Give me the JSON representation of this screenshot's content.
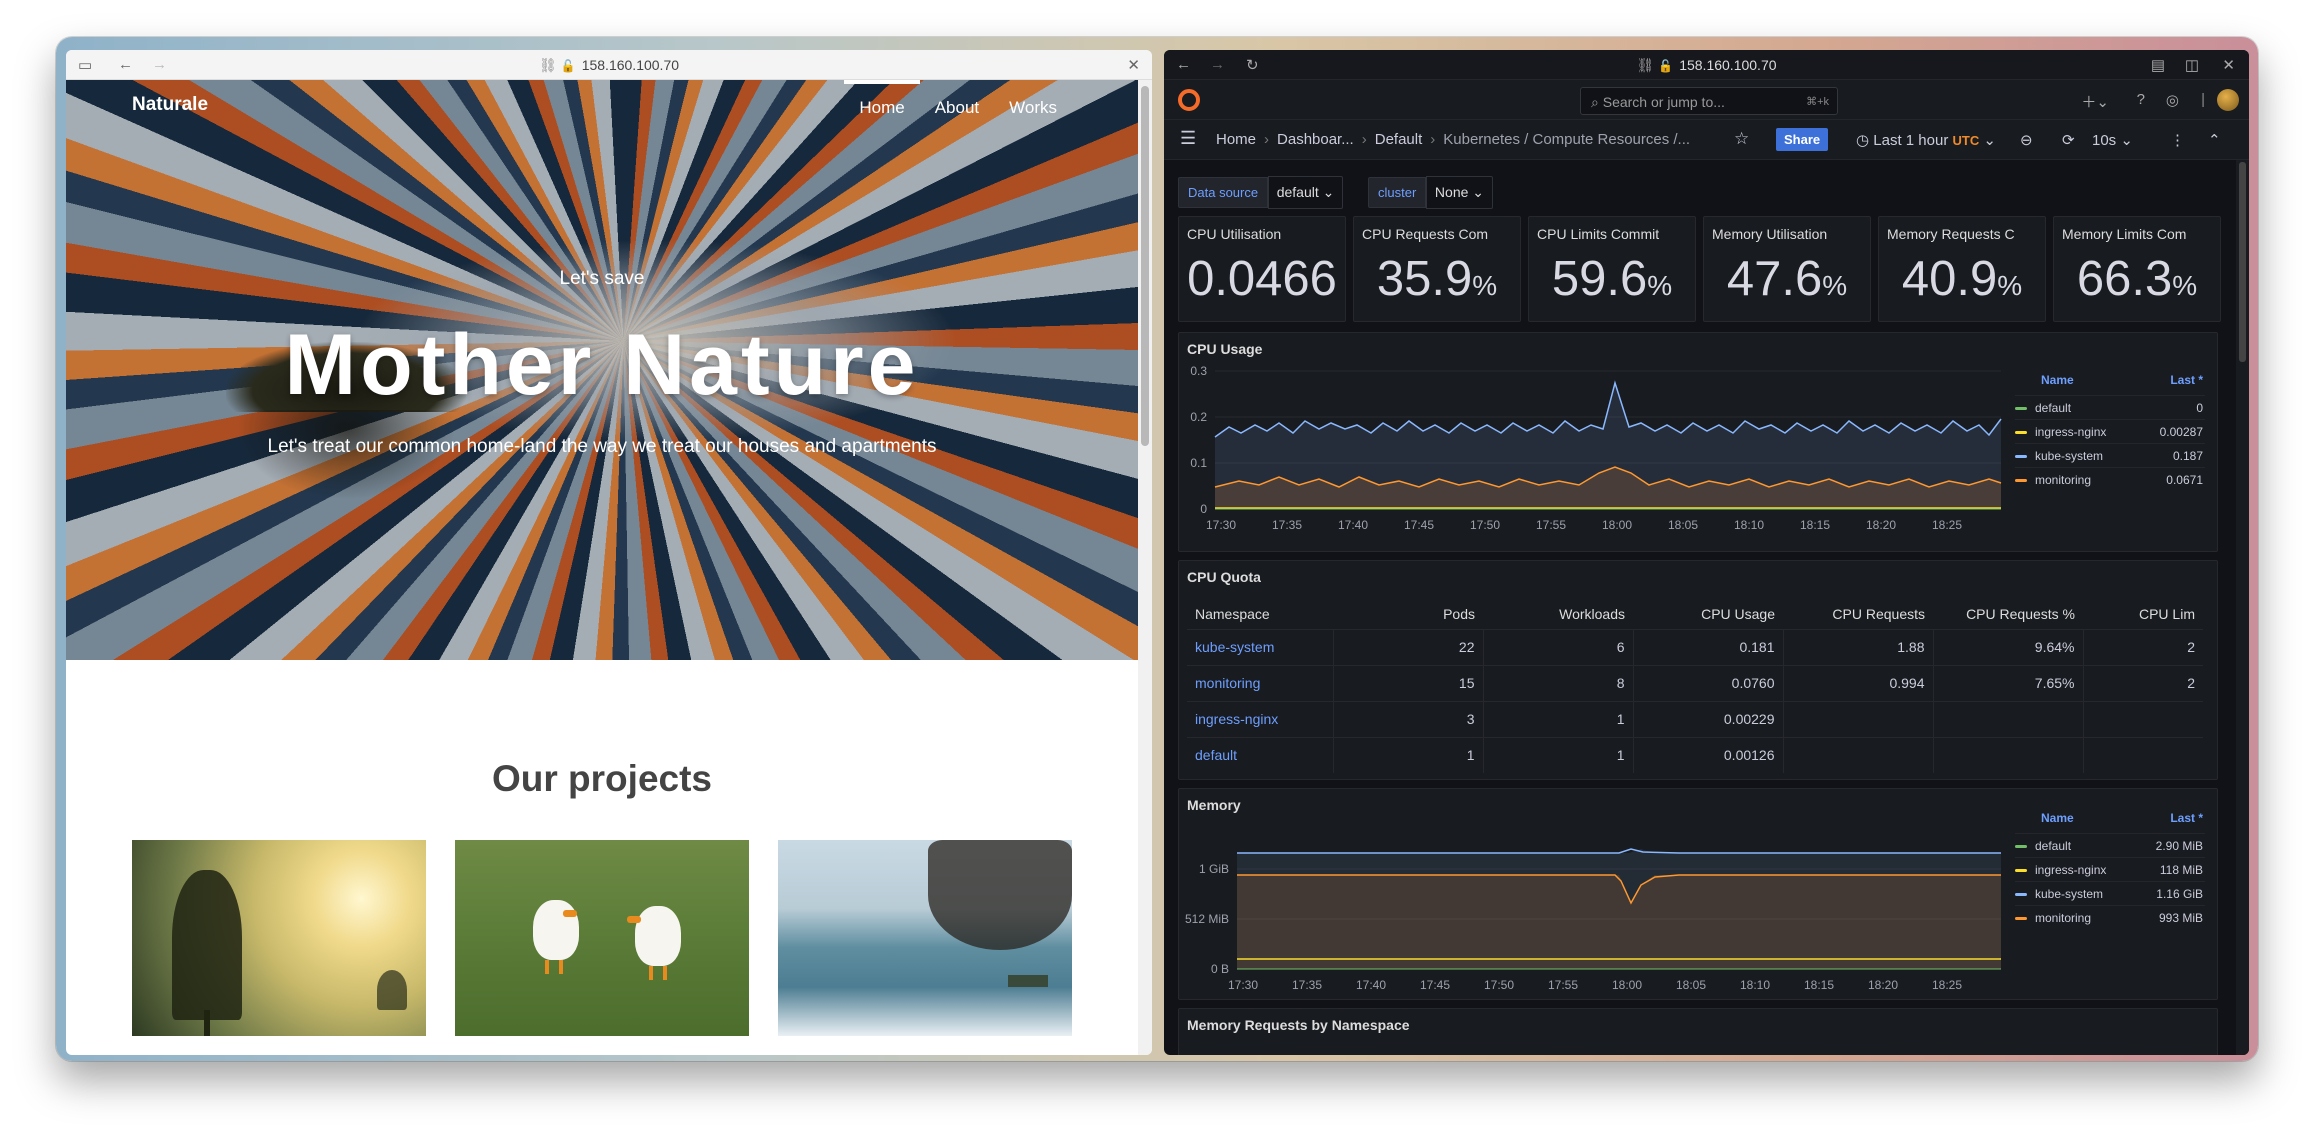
{
  "left_browser": {
    "url": "158.160.100.70",
    "site": {
      "brand": "Naturale",
      "nav": [
        "Home",
        "About",
        "Works"
      ],
      "hero_subtitle": "Let's save",
      "hero_title": "Mother Nature",
      "hero_description": "Let's treat our common home-land the way we treat our houses and apartments",
      "projects_title": "Our projects"
    }
  },
  "right_browser": {
    "url": "158.160.100.70",
    "search_placeholder": "Search or jump to...",
    "search_shortcut": "⌘+k",
    "breadcrumbs": [
      "Home",
      "Dashboar...",
      "Default",
      "Kubernetes / Compute Resources /..."
    ],
    "share_label": "Share",
    "time_range": "Last 1 hour",
    "timezone": "UTC",
    "refresh": "10s",
    "variables": [
      {
        "label": "Data source",
        "value": "default"
      },
      {
        "label": "cluster",
        "value": "None"
      }
    ],
    "stats": [
      {
        "title": "CPU Utilisation",
        "value": "0.0466",
        "unit": ""
      },
      {
        "title": "CPU Requests Com",
        "value": "35.9",
        "unit": "%"
      },
      {
        "title": "CPU Limits Commit",
        "value": "59.6",
        "unit": "%"
      },
      {
        "title": "Memory Utilisation",
        "value": "47.6",
        "unit": "%"
      },
      {
        "title": "Memory Requests C",
        "value": "40.9",
        "unit": "%"
      },
      {
        "title": "Memory Limits Com",
        "value": "66.3",
        "unit": "%"
      }
    ],
    "cpu_usage": {
      "title": "CPU Usage",
      "legend_header": {
        "name": "Name",
        "last": "Last *"
      },
      "legend": [
        {
          "name": "default",
          "last": "0",
          "color": "#73bf69"
        },
        {
          "name": "ingress-nginx",
          "last": "0.00287",
          "color": "#fade2a"
        },
        {
          "name": "kube-system",
          "last": "0.187",
          "color": "#8ab8ff"
        },
        {
          "name": "monitoring",
          "last": "0.0671",
          "color": "#ff9830"
        }
      ],
      "y_ticks": [
        "0.3",
        "0.2",
        "0.1",
        "0"
      ],
      "x_ticks": [
        "17:30",
        "17:35",
        "17:40",
        "17:45",
        "17:50",
        "17:55",
        "18:00",
        "18:05",
        "18:10",
        "18:15",
        "18:20",
        "18:25"
      ]
    },
    "cpu_quota": {
      "title": "CPU Quota",
      "columns": [
        "Namespace",
        "Pods",
        "Workloads",
        "CPU Usage",
        "CPU Requests",
        "CPU Requests %",
        "CPU Lim"
      ],
      "rows": [
        [
          "kube-system",
          "22",
          "6",
          "0.181",
          "1.88",
          "9.64%",
          "2"
        ],
        [
          "monitoring",
          "15",
          "8",
          "0.0760",
          "0.994",
          "7.65%",
          "2"
        ],
        [
          "ingress-nginx",
          "3",
          "1",
          "0.00229",
          "",
          "",
          ""
        ],
        [
          "default",
          "1",
          "1",
          "0.00126",
          "",
          "",
          ""
        ]
      ]
    },
    "memory": {
      "title": "Memory",
      "legend_header": {
        "name": "Name",
        "last": "Last *"
      },
      "legend": [
        {
          "name": "default",
          "last": "2.90 MiB",
          "color": "#73bf69"
        },
        {
          "name": "ingress-nginx",
          "last": "118 MiB",
          "color": "#fade2a"
        },
        {
          "name": "kube-system",
          "last": "1.16 GiB",
          "color": "#8ab8ff"
        },
        {
          "name": "monitoring",
          "last": "993 MiB",
          "color": "#ff9830"
        }
      ],
      "y_ticks": [
        "1 GiB",
        "512 MiB",
        "0 B"
      ],
      "x_ticks": [
        "17:30",
        "17:35",
        "17:40",
        "17:45",
        "17:50",
        "17:55",
        "18:00",
        "18:05",
        "18:10",
        "18:15",
        "18:20",
        "18:25"
      ]
    },
    "memory_requests_title": "Memory Requests by Namespace"
  }
}
